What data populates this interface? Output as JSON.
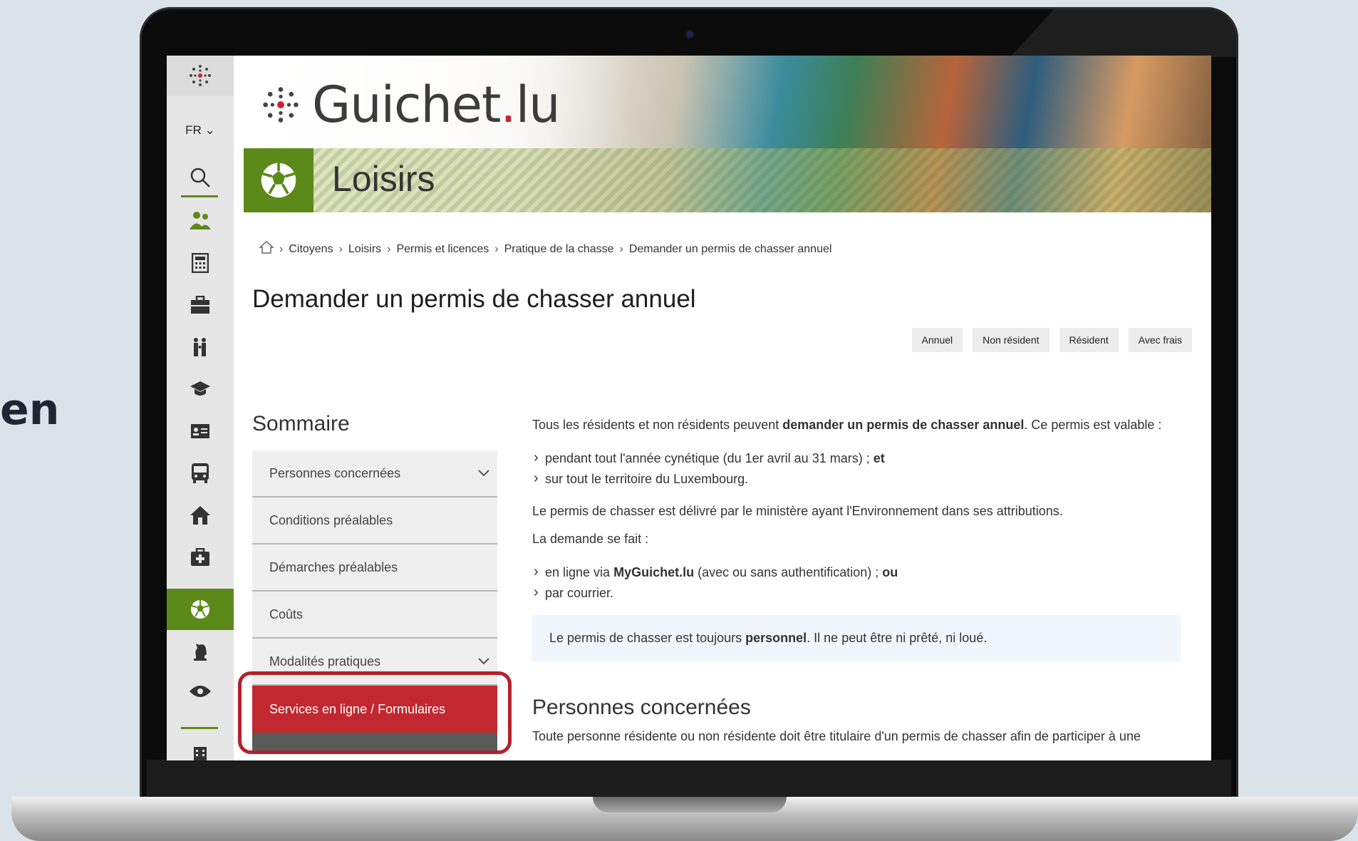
{
  "slide": {
    "partial_text": "en"
  },
  "sidebar": {
    "language": "FR ⌄",
    "icons": [
      "search-icon",
      "people-icon",
      "calculator-icon",
      "briefcase-icon",
      "family-icon",
      "graduation-cap-icon",
      "id-card-icon",
      "bus-icon",
      "home-icon",
      "medical-kit-icon",
      "soccer-ball-icon",
      "chess-knight-icon",
      "eye-icon",
      "building-icon"
    ]
  },
  "header": {
    "brand_main": "Guichet",
    "brand_dot": ".",
    "brand_tld": "lu",
    "section_title": "Loisirs",
    "accent_color": "#5c8a1a"
  },
  "breadcrumb": [
    "Citoyens",
    "Loisirs",
    "Permis et licences",
    "Pratique de la chasse",
    "Demander un permis de chasser annuel"
  ],
  "page": {
    "title": "Demander un permis de chasser annuel",
    "tags": [
      "Annuel",
      "Non résident",
      "Résident",
      "Avec frais"
    ]
  },
  "sommaire": {
    "title": "Sommaire",
    "items": [
      {
        "label": "Personnes concernées",
        "expandable": true
      },
      {
        "label": "Conditions préalables",
        "expandable": false
      },
      {
        "label": "Démarches préalables",
        "expandable": false
      },
      {
        "label": "Coûts",
        "expandable": false
      },
      {
        "label": "Modalités pratiques",
        "expandable": true
      },
      {
        "label": "Services en ligne / Formulaires",
        "expandable": false,
        "active": true
      }
    ],
    "active_color": "#c2282f"
  },
  "content": {
    "intro_before": "Tous les résidents et non résidents peuvent ",
    "intro_bold": "demander un permis de chasser annuel",
    "intro_after": ". Ce permis est valable :",
    "bullets1": [
      {
        "text": "pendant tout l'année cynétique (du 1er avril au 31 mars) ; ",
        "bold": "et"
      },
      {
        "text": "sur tout le territoire du Luxembourg.",
        "bold": ""
      }
    ],
    "para2": "Le permis de chasser est délivré par le ministère ayant l'Environnement dans ses attributions.",
    "para3": "La demande se fait :",
    "bullets2_a_pre": "en ligne via ",
    "bullets2_a_bold": "MyGuichet.lu",
    "bullets2_a_post": " (avec ou sans authentification) ; ",
    "bullets2_a_bold2": "ou",
    "bullets2_b": "par courrier.",
    "notice_pre": "Le permis de chasser est toujours ",
    "notice_bold": "personnel",
    "notice_post": ". Il ne peut être ni prêté, ni loué.",
    "subheading": "Personnes concernées",
    "clipped_line": "Toute personne résidente ou non résidente doit être titulaire d'un permis de chasser afin de participer à une"
  }
}
